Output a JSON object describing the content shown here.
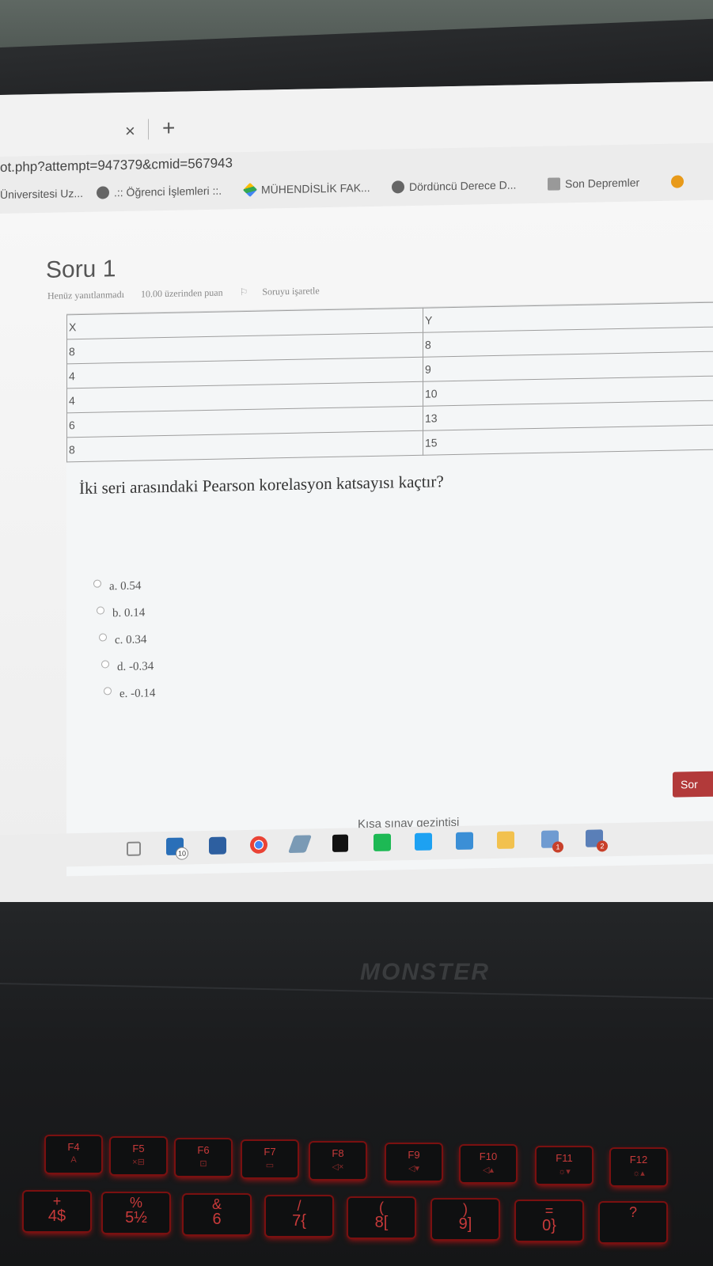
{
  "browser": {
    "tab_close_icon": "×",
    "new_tab_icon": "+",
    "url": "ot.php?attempt=947379&cmid=567943",
    "bookmarks": [
      {
        "label": "Üniversitesi Uz...",
        "icon": "none"
      },
      {
        "label": ".:: Öğrenci İşlemleri ::.",
        "icon": "globe-icon"
      },
      {
        "label": "MÜHENDİSLİK FAK...",
        "icon": "drive-icon"
      },
      {
        "label": "Dördüncü Derece D...",
        "icon": "globe-icon"
      },
      {
        "label": "Son Depremler",
        "icon": "seismic-icon"
      }
    ]
  },
  "quiz": {
    "title": "Soru 1",
    "status": "Henüz yanıtlanmadı",
    "points": "10.00 üzerinden puan",
    "flag_label": "Soruyu işaretle",
    "table": {
      "headers": [
        "X",
        "Y"
      ],
      "rows": [
        [
          "8",
          "8"
        ],
        [
          "4",
          "9"
        ],
        [
          "4",
          "10"
        ],
        [
          "6",
          "13"
        ],
        [
          "8",
          "15"
        ]
      ]
    },
    "question": "İki seri arasındaki Pearson korelasyon katsayısı kaçtır?",
    "options": [
      "a. 0.54",
      "b. 0.14",
      "c. 0.34",
      "d. -0.34",
      "e. -0.14"
    ],
    "next_button": "Sor",
    "nav_label": "Kısa sınav gezintisi"
  },
  "taskbar": {
    "mail_badge": "10",
    "app1_badge": "1",
    "app2_badge": "2"
  },
  "laptop": {
    "brand": "MONSTER",
    "fkeys": [
      {
        "top": "F4",
        "sub": "A"
      },
      {
        "top": "F5",
        "sub": "×⊟"
      },
      {
        "top": "F6",
        "sub": "⊡"
      },
      {
        "top": "F7",
        "sub": "▭"
      },
      {
        "top": "F8",
        "sub": "◁×"
      },
      {
        "top": "F9",
        "sub": "◁▾"
      },
      {
        "top": "F10",
        "sub": "◁▴"
      },
      {
        "top": "F11",
        "sub": "☼▾"
      },
      {
        "top": "F12",
        "sub": "☼▴"
      }
    ],
    "numkeys": [
      {
        "top": "+",
        "sub": "4$"
      },
      {
        "top": "%",
        "sub": "5½"
      },
      {
        "top": "&",
        "sub": "6"
      },
      {
        "top": "/",
        "sub": "7{"
      },
      {
        "top": "(",
        "sub": "8["
      },
      {
        "top": ")",
        "sub": "9]"
      },
      {
        "top": "=",
        "sub": "0}"
      },
      {
        "top": "?",
        "sub": ""
      }
    ]
  }
}
